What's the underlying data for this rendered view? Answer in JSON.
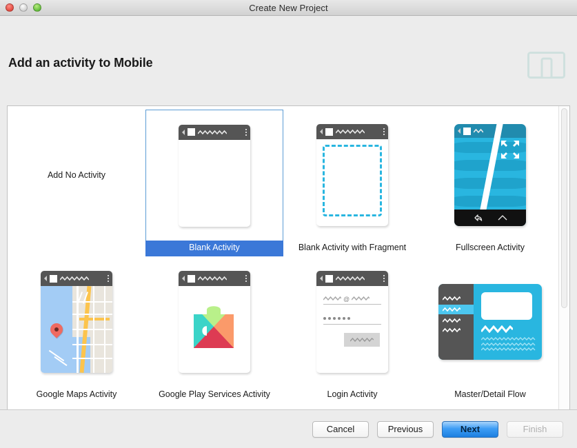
{
  "window": {
    "title": "Create New Project",
    "traffic_lights": [
      "close-button",
      "minimize-button",
      "zoom-button"
    ]
  },
  "header": {
    "page_title": "Add an activity to Mobile",
    "device_icon": "tablet-phone-outline-icon"
  },
  "templates": [
    {
      "label": "Add No Activity",
      "thumb": "none",
      "selected": false
    },
    {
      "label": "Blank Activity",
      "thumb": "blank",
      "selected": true
    },
    {
      "label": "Blank Activity with Fragment",
      "thumb": "fragment",
      "selected": false
    },
    {
      "label": "Fullscreen Activity",
      "thumb": "fullscreen",
      "selected": false
    },
    {
      "label": "Google Maps Activity",
      "thumb": "maps",
      "selected": false
    },
    {
      "label": "Google Play Services Activity",
      "thumb": "play-services",
      "selected": false
    },
    {
      "label": "Login Activity",
      "thumb": "login",
      "selected": false
    },
    {
      "label": "Master/Detail Flow",
      "thumb": "master-detail",
      "selected": false
    }
  ],
  "scrollbar": {
    "orientation": "vertical",
    "thumb_position": "top"
  },
  "footer": {
    "cancel": "Cancel",
    "previous": "Previous",
    "next": "Next",
    "finish": "Finish"
  },
  "colors": {
    "selection_blue": "#3b78d8",
    "accent_cyan": "#29b6e0",
    "appbar_gray": "#555555",
    "dialog_bg": "#ececec",
    "default_button_blue": "#1d7fe0"
  }
}
